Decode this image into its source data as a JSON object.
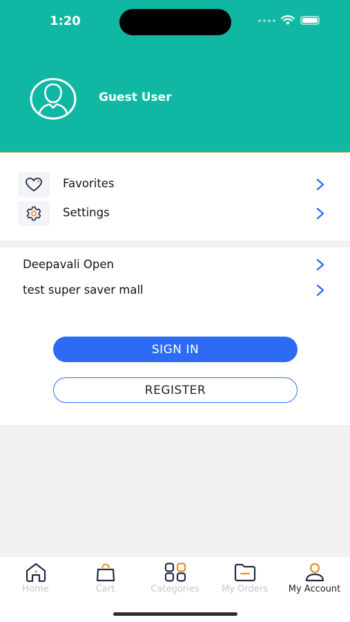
{
  "status_bar": {
    "time": "1:20"
  },
  "header": {
    "user_name": "Guest User",
    "avatar_icon": "user-outline-icon",
    "bg_color": "#10b8a4"
  },
  "menu": {
    "items": [
      {
        "label": "Favorites",
        "icon": "heart-icon"
      },
      {
        "label": "Settings",
        "icon": "gear-icon"
      }
    ]
  },
  "shops": {
    "items": [
      {
        "label": "Deepavali Open"
      },
      {
        "label": "test super saver mall"
      }
    ]
  },
  "auth": {
    "sign_in_label": "SIGN IN",
    "register_label": "REGISTER",
    "accent_color": "#2d6bf5"
  },
  "tabbar": {
    "tabs": [
      {
        "label": "Home",
        "icon": "home-icon",
        "active": false
      },
      {
        "label": "Cart",
        "icon": "shopping-bag-icon",
        "active": false
      },
      {
        "label": "Categories",
        "icon": "grid-icon",
        "active": false
      },
      {
        "label": "My Orders",
        "icon": "folder-icon",
        "active": false
      },
      {
        "label": "My Account",
        "icon": "user-icon",
        "active": true
      }
    ]
  }
}
